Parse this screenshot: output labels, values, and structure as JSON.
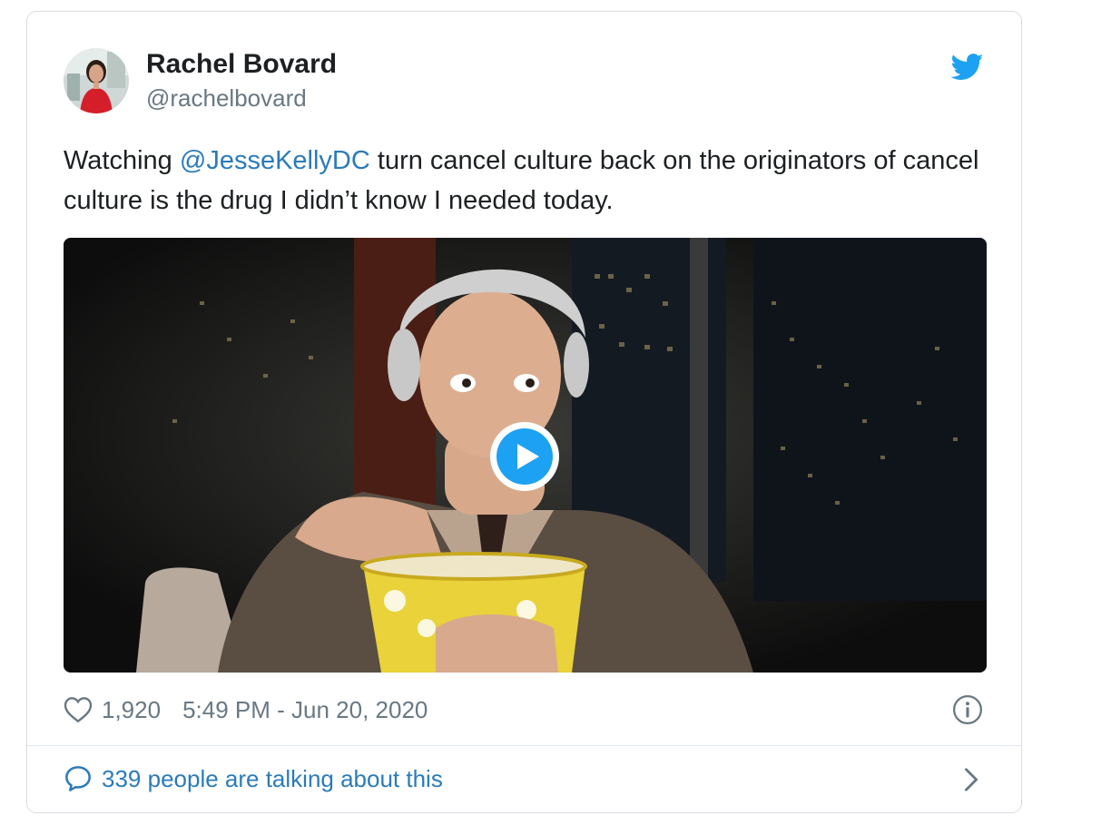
{
  "tweet": {
    "author_name": "Rachel Bovard",
    "author_handle": "@rachelbovard",
    "text_before": "Watching ",
    "mention": "@JesseKellyDC",
    "text_after": " turn cancel culture back on the originators of cancel culture is the drug I didn’t know I needed today.",
    "likes": "1,920",
    "timestamp": "5:49 PM - Jun 20, 2020",
    "talking": "339 people are talking about this"
  },
  "colors": {
    "link": "#2b7bb9",
    "twitter_blue": "#1da1f2",
    "muted": "#697882",
    "text": "#1c2022"
  },
  "icons": {
    "brand": "twitter-bird-icon",
    "play": "play-icon",
    "like": "heart-icon",
    "info": "info-icon",
    "reply": "speech-bubble-icon",
    "more": "chevron-right-icon"
  }
}
